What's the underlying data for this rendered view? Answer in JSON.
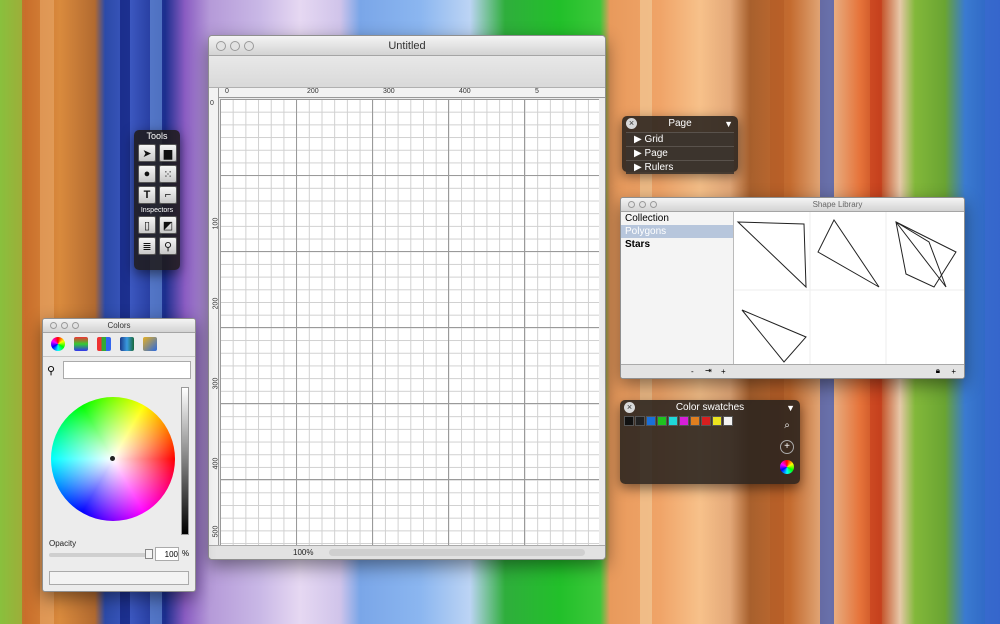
{
  "document_window": {
    "title": "Untitled",
    "ruler_top": [
      "0",
      "200",
      "300",
      "400",
      "5"
    ],
    "ruler_left": [
      "0",
      "100",
      "200",
      "300",
      "400",
      "500"
    ],
    "zoom": "100%"
  },
  "tools_palette": {
    "title": "Tools",
    "inspectors_label": "Inspectors",
    "tool_icons": [
      "pointer-icon",
      "rectangle-icon",
      "circle-icon",
      "select-points-icon",
      "text-icon",
      "line-icon"
    ],
    "inspector_icons": [
      "page-icon",
      "style-icon",
      "list-icon",
      "magnifier-icon"
    ]
  },
  "colors_panel": {
    "title": "Colors",
    "mode_icons": [
      "color-wheel-icon",
      "sliders-icon",
      "palettes-icon",
      "spectrum-icon",
      "crayons-icon"
    ],
    "search_placeholder": "",
    "opacity_label": "Opacity",
    "opacity_value": "100",
    "opacity_unit": "%"
  },
  "page_hud": {
    "title": "Page",
    "rows": [
      {
        "label": "Grid"
      },
      {
        "label": "Page"
      },
      {
        "label": "Rulers"
      }
    ]
  },
  "shape_library": {
    "title": "Shape Library",
    "collections": [
      {
        "label": "Collection"
      },
      {
        "label": "Polygons",
        "selected": true
      },
      {
        "label": "Stars"
      }
    ]
  },
  "color_swatches": {
    "title": "Color swatches",
    "swatches": [
      "#111111",
      "#222222",
      "#1a6fd8",
      "#1fc21f",
      "#1fd8d8",
      "#d81fd8",
      "#e07e1f",
      "#d81f1f",
      "#ece41f",
      "#f4f4f4"
    ]
  }
}
